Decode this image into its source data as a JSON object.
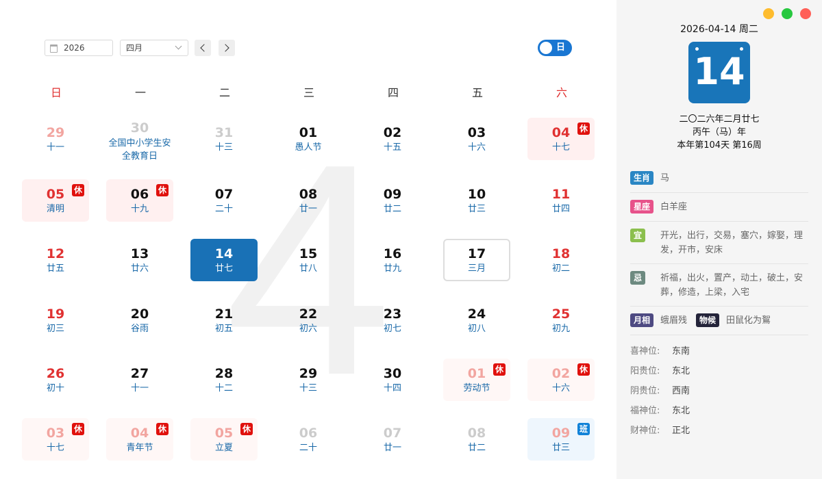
{
  "toolbar": {
    "year_value": "2026",
    "month_value": "四月",
    "view_toggle_label": "日"
  },
  "background_month": "4",
  "weekdays": [
    "日",
    "一",
    "二",
    "三",
    "四",
    "五",
    "六"
  ],
  "days": [
    {
      "d": "29",
      "s": "十一"
    },
    {
      "d": "30",
      "s": "全国中小学生安全教育日"
    },
    {
      "d": "31",
      "s": "十三"
    },
    {
      "d": "01",
      "s": "愚人节"
    },
    {
      "d": "02",
      "s": "十五"
    },
    {
      "d": "03",
      "s": "十六"
    },
    {
      "d": "04",
      "s": "十七",
      "badge": "休"
    },
    {
      "d": "05",
      "s": "清明",
      "badge": "休"
    },
    {
      "d": "06",
      "s": "十九",
      "badge": "休"
    },
    {
      "d": "07",
      "s": "二十"
    },
    {
      "d": "08",
      "s": "廿一"
    },
    {
      "d": "09",
      "s": "廿二"
    },
    {
      "d": "10",
      "s": "廿三"
    },
    {
      "d": "11",
      "s": "廿四"
    },
    {
      "d": "12",
      "s": "廿五"
    },
    {
      "d": "13",
      "s": "廿六"
    },
    {
      "d": "14",
      "s": "廿七"
    },
    {
      "d": "15",
      "s": "廿八"
    },
    {
      "d": "16",
      "s": "廿九"
    },
    {
      "d": "17",
      "s": "三月"
    },
    {
      "d": "18",
      "s": "初二"
    },
    {
      "d": "19",
      "s": "初三"
    },
    {
      "d": "20",
      "s": "谷雨"
    },
    {
      "d": "21",
      "s": "初五"
    },
    {
      "d": "22",
      "s": "初六"
    },
    {
      "d": "23",
      "s": "初七"
    },
    {
      "d": "24",
      "s": "初八"
    },
    {
      "d": "25",
      "s": "初九"
    },
    {
      "d": "26",
      "s": "初十"
    },
    {
      "d": "27",
      "s": "十一"
    },
    {
      "d": "28",
      "s": "十二"
    },
    {
      "d": "29",
      "s": "十三"
    },
    {
      "d": "30",
      "s": "十四"
    },
    {
      "d": "01",
      "s": "劳动节",
      "badge": "休"
    },
    {
      "d": "02",
      "s": "十六",
      "badge": "休"
    },
    {
      "d": "03",
      "s": "十七",
      "badge": "休"
    },
    {
      "d": "04",
      "s": "青年节",
      "badge": "休"
    },
    {
      "d": "05",
      "s": "立夏",
      "badge": "休"
    },
    {
      "d": "06",
      "s": "二十"
    },
    {
      "d": "07",
      "s": "廿一"
    },
    {
      "d": "08",
      "s": "廿二"
    },
    {
      "d": "09",
      "s": "廿三",
      "badge": "班"
    }
  ],
  "side": {
    "date_line": "2026-04-14 周二",
    "big_day": "14",
    "lunar_date": "二〇二六年二月廿七",
    "ganzhi_year": "丙午（马）年",
    "year_progress": "本年第104天 第16周",
    "zodiac_tag": "生肖",
    "zodiac_value": "马",
    "constellation_tag": "星座",
    "constellation_value": "白羊座",
    "yi_tag": "宜",
    "yi_value": "开光，出行，交易，塞穴，嫁娶，理发，开市，安床",
    "ji_tag": "忌",
    "ji_value": "祈福，出火，置产，动土，破土，安葬，修造，上梁，入宅",
    "moon_tag": "月相",
    "moon_value": "蛾眉残",
    "phenology_tag": "物候",
    "phenology_value": "田鼠化为鴽",
    "positions": [
      {
        "label": "喜神位:",
        "value": "东南"
      },
      {
        "label": "阳贵位:",
        "value": "东北"
      },
      {
        "label": "阴贵位:",
        "value": "西南"
      },
      {
        "label": "福神位:",
        "value": "东北"
      },
      {
        "label": "财神位:",
        "value": "正北"
      }
    ]
  },
  "colors": {
    "accent": "#1971b6",
    "weekend_red": "#e03131",
    "lunar_blue": "#1868a8",
    "holiday_bg": "#fff0f0",
    "rest_badge": "#e0110d",
    "work_badge": "#1182d8"
  }
}
